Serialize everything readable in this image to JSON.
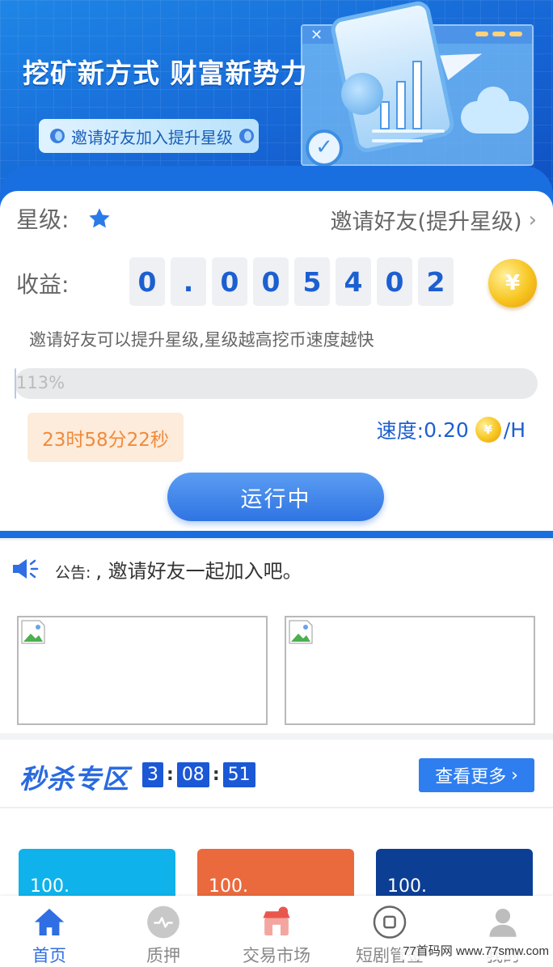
{
  "banner": {
    "title": "挖矿新方式 财富新势力",
    "pill_text": "邀请好友加入提升星级"
  },
  "card": {
    "star_label": "星级:",
    "invite_link": "邀请好友(提升星级)",
    "income_label": "收益:",
    "income_digits": [
      "0",
      ".",
      "0",
      "0",
      "5",
      "4",
      "0",
      "2"
    ],
    "coin_symbol": "¥",
    "hint": "邀请好友可以提升星级,星级越高挖币速度越快",
    "progress_text": "113%",
    "timer": "23时58分22秒",
    "speed_label": "速度:",
    "speed_value": "0.20",
    "speed_unit": "/H",
    "run_button": "运行中"
  },
  "notice": {
    "label": "公告:",
    "message": ", 邀请好友一起加入吧。"
  },
  "flash": {
    "title": "秒杀专区",
    "countdown": [
      "3",
      "08",
      "51"
    ],
    "more_button": "查看更多"
  },
  "products": [
    {
      "price": "100.",
      "color": "#0fb2ea"
    },
    {
      "price": "100.",
      "color": "#ea6a3e"
    },
    {
      "price": "100.",
      "color": "#0c3f94"
    }
  ],
  "tabs": [
    {
      "label": "首页",
      "icon": "home-icon",
      "active": true
    },
    {
      "label": "质押",
      "icon": "pulse-icon",
      "active": false
    },
    {
      "label": "交易市场",
      "icon": "store-icon",
      "active": false
    },
    {
      "label": "短剧管签",
      "icon": "circle-square-icon",
      "active": false
    },
    {
      "label": "我的",
      "icon": "user-icon",
      "active": false
    }
  ],
  "watermark": "77首码网 www.77smw.com",
  "colors": {
    "accent": "#2f6ee3",
    "banner": "#1664d4",
    "timer_bg": "#fdebdb",
    "timer_text": "#f08a3a"
  }
}
